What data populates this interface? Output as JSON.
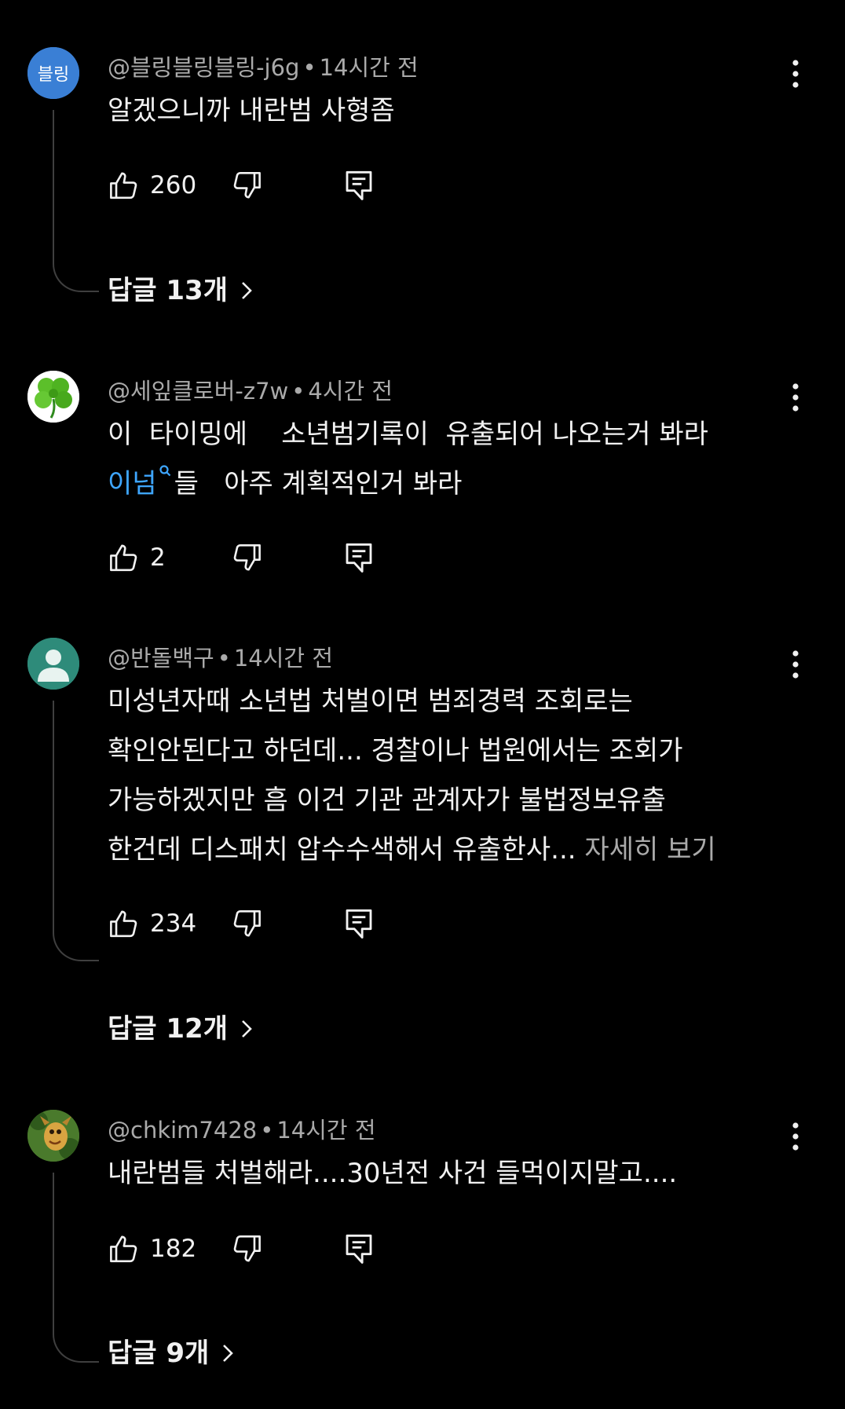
{
  "comments": [
    {
      "username": "@블링블링블링-j6g",
      "time": "14시간 전",
      "avatar_text": "블링",
      "avatar_color": "#3a7fd5",
      "lines": [
        "알겠으니까 내란범 사형좀"
      ],
      "likes": "260",
      "replies_label": "답글 13개"
    },
    {
      "username": "@세잎클로버-z7w",
      "time": "4시간 전",
      "avatar_icon": "clover-icon",
      "line1": "이  타이밍에    소년범기록이  유출되어 나오는거 봐라",
      "line2_mention": "이넘",
      "line2_rest": "들   아주 계획적인거 봐라",
      "likes": "2"
    },
    {
      "username": "@반돌백구",
      "time": "14시간 전",
      "avatar_icon": "default-person-icon",
      "avatar_color": "#2e8b7a",
      "lines": [
        "미성년자때 소년법 처벌이면 범죄경력 조회로는",
        "확인안된다고 하던데... 경찰이나 법원에서는 조회가",
        "가능하겠지만 흠 이건 기관 관계자가 불법정보유출",
        "한건데 디스패치 압수수색해서 유출한사..."
      ],
      "read_more": "자세히 보기",
      "likes": "234",
      "replies_label": "답글 12개"
    },
    {
      "username": "@chkim7428",
      "time": "14시간 전",
      "avatar_icon": "cartoon-character-icon",
      "lines": [
        "내란범들 처벌해라....30년전 사건 들먹이지말고...."
      ],
      "likes": "182",
      "replies_label": "답글 9개"
    }
  ],
  "dot": "•",
  "icons": {
    "like": "thumbs-up-icon",
    "dislike": "thumbs-down-icon",
    "reply": "reply-comment-icon",
    "menu": "more-vert-icon",
    "chevron": "chevron-right-icon",
    "search": "search-icon"
  }
}
